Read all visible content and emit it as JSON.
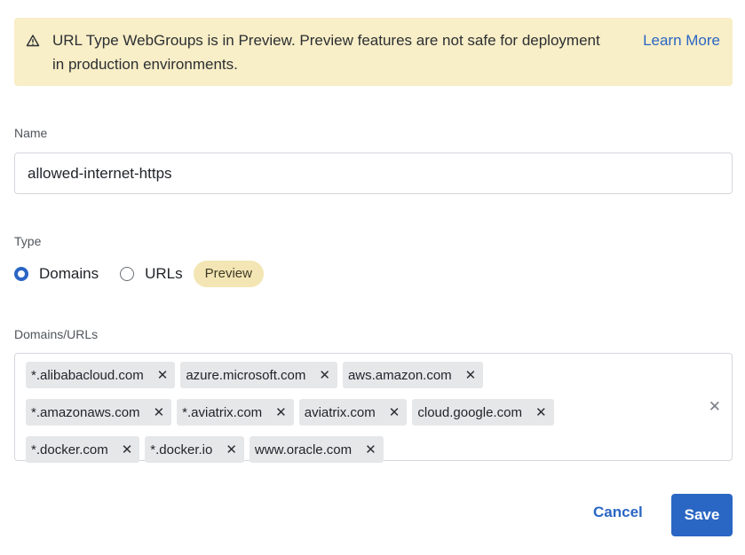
{
  "banner": {
    "message": "URL Type WebGroups is in Preview. Preview features are not safe for deployment in production environments.",
    "learn_more": "Learn More",
    "icon": "warning-triangle-icon"
  },
  "name_field": {
    "label": "Name",
    "value": "allowed-internet-https"
  },
  "type_field": {
    "label": "Type",
    "options": [
      {
        "label": "Domains",
        "selected": true
      },
      {
        "label": "URLs",
        "selected": false
      }
    ],
    "preview_badge": "Preview"
  },
  "domains_field": {
    "label": "Domains/URLs",
    "tags": [
      "*.alibabacloud.com",
      "azure.microsoft.com",
      "aws.amazon.com",
      "*.amazonaws.com",
      "*.aviatrix.com",
      "aviatrix.com",
      "cloud.google.com",
      "*.docker.com",
      "*.docker.io",
      "www.oracle.com"
    ],
    "remove_glyph": "✕",
    "clear_glyph": "✕"
  },
  "actions": {
    "cancel": "Cancel",
    "save": "Save"
  },
  "colors": {
    "accent": "#2a66c4",
    "banner_bg": "#f8eec7",
    "tag_bg": "#e6e7e9"
  }
}
